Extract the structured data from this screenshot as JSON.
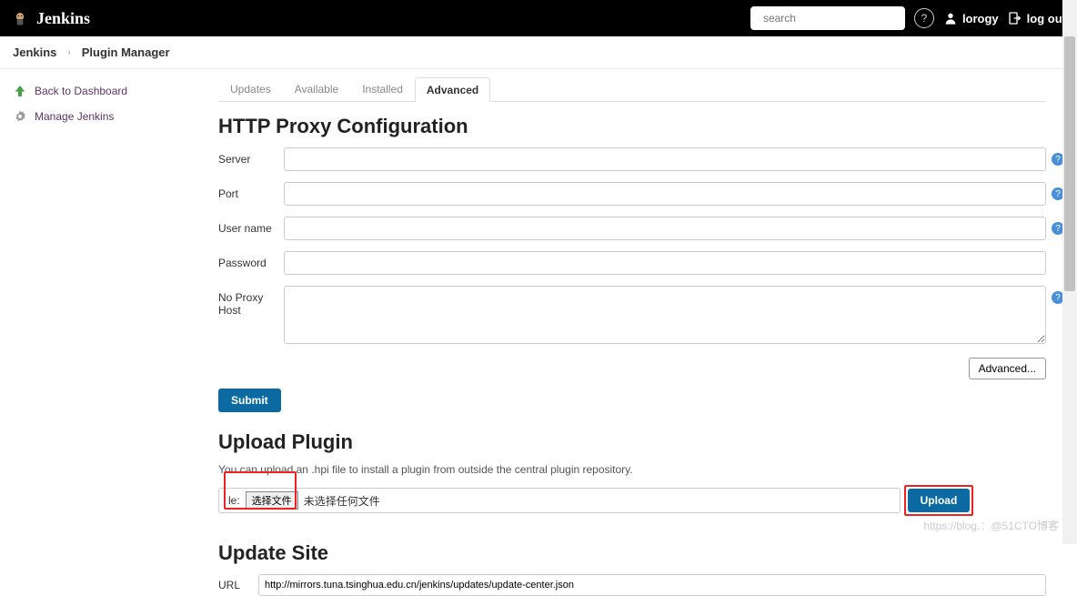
{
  "header": {
    "brand": "Jenkins",
    "search_placeholder": "search",
    "username": "lorogy",
    "logout": "log out"
  },
  "breadcrumb": {
    "items": [
      "Jenkins",
      "Plugin Manager"
    ]
  },
  "sidebar": {
    "items": [
      {
        "label": "Back to Dashboard"
      },
      {
        "label": "Manage Jenkins"
      }
    ]
  },
  "tabs": {
    "items": [
      "Updates",
      "Available",
      "Installed",
      "Advanced"
    ],
    "active": "Advanced"
  },
  "proxy": {
    "heading": "HTTP Proxy Configuration",
    "labels": {
      "server": "Server",
      "port": "Port",
      "username": "User name",
      "password": "Password",
      "noproxy": "No Proxy Host"
    },
    "advanced_btn": "Advanced...",
    "submit_btn": "Submit"
  },
  "upload": {
    "heading": "Upload Plugin",
    "description": "You can upload an .hpi file to install a plugin from outside the central plugin repository.",
    "file_label": "le:",
    "choose_btn": "选择文件",
    "file_status": "未选择任何文件",
    "upload_btn": "Upload"
  },
  "updatesite": {
    "heading": "Update Site",
    "url_label": "URL",
    "url_value": "http://mirrors.tuna.tsinghua.edu.cn/jenkins/updates/update-center.json"
  },
  "watermark": "https://blog.：@51CTO博客"
}
